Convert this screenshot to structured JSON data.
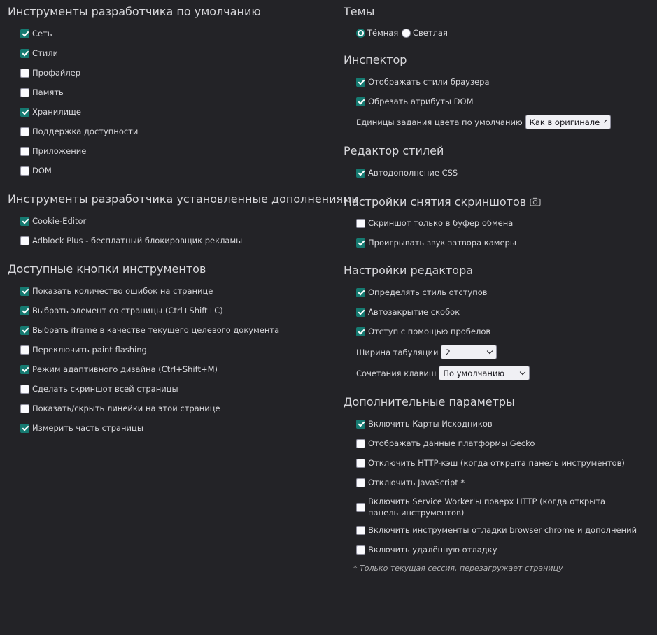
{
  "left": {
    "default_tools": {
      "title": "Инструменты разработчика по умолчанию",
      "items": [
        {
          "label": "Сеть",
          "checked": true
        },
        {
          "label": "Стили",
          "checked": true
        },
        {
          "label": "Профайлер",
          "checked": false
        },
        {
          "label": "Память",
          "checked": false
        },
        {
          "label": "Хранилище",
          "checked": true
        },
        {
          "label": "Поддержка доступности",
          "checked": false
        },
        {
          "label": "Приложение",
          "checked": false
        },
        {
          "label": "DOM",
          "checked": false
        }
      ]
    },
    "addon_tools": {
      "title": "Инструменты разработчика установленные дополнениями",
      "items": [
        {
          "label": "Cookie-Editor",
          "checked": true
        },
        {
          "label": "Adblock Plus - бесплатный блокировщик рекламы",
          "checked": false
        }
      ]
    },
    "toolbox_buttons": {
      "title": "Доступные кнопки инструментов",
      "items": [
        {
          "label": "Показать количество ошибок на странице",
          "checked": true
        },
        {
          "label": "Выбрать элемент со страницы (Ctrl+Shift+C)",
          "checked": true
        },
        {
          "label": "Выбрать iframe в качестве текущего целевого документа",
          "checked": true
        },
        {
          "label": "Переключить paint flashing",
          "checked": false
        },
        {
          "label": "Режим адаптивного дизайна (Ctrl+Shift+M)",
          "checked": true
        },
        {
          "label": "Сделать скриншот всей страницы",
          "checked": false
        },
        {
          "label": "Показать/скрыть линейки на этой странице",
          "checked": false
        },
        {
          "label": "Измерить часть страницы",
          "checked": true
        }
      ]
    }
  },
  "right": {
    "themes": {
      "title": "Темы",
      "options": [
        {
          "label": "Тёмная",
          "selected": true
        },
        {
          "label": "Светлая",
          "selected": false
        }
      ]
    },
    "inspector": {
      "title": "Инспектор",
      "items": [
        {
          "label": "Отображать стили браузера",
          "checked": true
        },
        {
          "label": "Обрезать атрибуты DOM",
          "checked": true
        }
      ],
      "color_unit_label": "Единицы задания цвета по умолчанию",
      "color_unit_value": "Как в оригинале"
    },
    "style_editor": {
      "title": "Редактор стилей",
      "items": [
        {
          "label": "Автодополнение CSS",
          "checked": true
        }
      ]
    },
    "screenshots": {
      "title": "Настройки снятия скриншотов",
      "icon": "camera-icon",
      "items": [
        {
          "label": "Скриншот только в буфер обмена",
          "checked": false
        },
        {
          "label": "Проигрывать звук затвора камеры",
          "checked": true
        }
      ]
    },
    "editor": {
      "title": "Настройки редактора",
      "items": [
        {
          "label": "Определять стиль отступов",
          "checked": true
        },
        {
          "label": "Автозакрытие скобок",
          "checked": true
        },
        {
          "label": "Отступ с помощью пробелов",
          "checked": true
        }
      ],
      "tab_width_label": "Ширина табуляции",
      "tab_width_value": "2",
      "keymap_label": "Сочетания клавиш",
      "keymap_value": "По умолчанию"
    },
    "advanced": {
      "title": "Дополнительные параметры",
      "items": [
        {
          "label": "Включить Карты Исходников",
          "checked": true
        },
        {
          "label": "Отображать данные платформы Gecko",
          "checked": false
        },
        {
          "label": "Отключить HTTP-кэш (когда открыта панель инструментов)",
          "checked": false
        },
        {
          "label": "Отключить JavaScript *",
          "checked": false
        },
        {
          "label": "Включить Service Worker'ы поверх HTTP (когда открыта панель инструментов)",
          "checked": false
        },
        {
          "label": "Включить инструменты отладки browser chrome и дополнений",
          "checked": false
        },
        {
          "label": "Включить удалённую отладку",
          "checked": false
        }
      ],
      "note": "* Только текущая сессия, перезагружает страницу"
    }
  },
  "colors": {
    "background": "#232327",
    "text": "#d7d7db",
    "accent": "#167a71"
  }
}
